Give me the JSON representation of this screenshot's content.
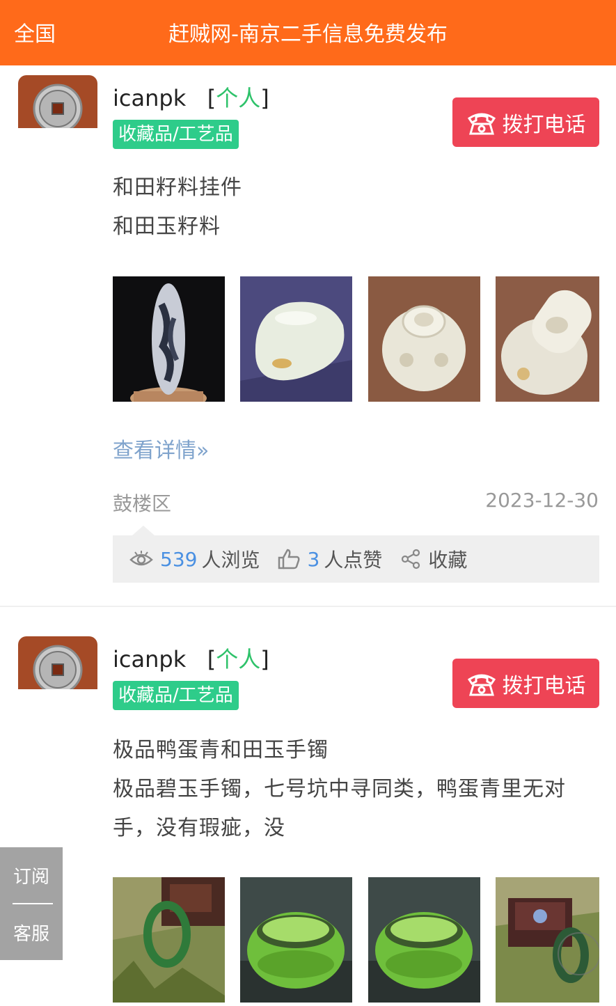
{
  "header": {
    "region": "全国",
    "title": "赶贼网-南京二手信息免费发布"
  },
  "posts": [
    {
      "username": "icanpk",
      "user_type": "个人",
      "category": "收藏品/工艺品",
      "call_label": "拨打电话",
      "title": "和田籽料挂件",
      "description": "和田玉籽料",
      "more_label": "查看详情»",
      "district": "鼓楼区",
      "date": "2023-12-30",
      "views": "539",
      "views_label": "人浏览",
      "likes": "3",
      "likes_label": "人点赞",
      "favorite_label": "收藏"
    },
    {
      "username": "icanpk",
      "user_type": "个人",
      "category": "收藏品/工艺品",
      "call_label": "拨打电话",
      "title": "极品鸭蛋青和田玉手镯",
      "description": "极品碧玉手镯，七号坑中寻同类，鸭蛋青里无对手，没有瑕疵，没"
    }
  ],
  "side_panel": {
    "subscribe": "订阅",
    "service": "客服"
  },
  "colors": {
    "header": "#ff6a1a",
    "call_button": "#ee4455",
    "category_badge": "#2ecc8a",
    "link": "#7fa3cc",
    "count": "#4a90e2"
  }
}
